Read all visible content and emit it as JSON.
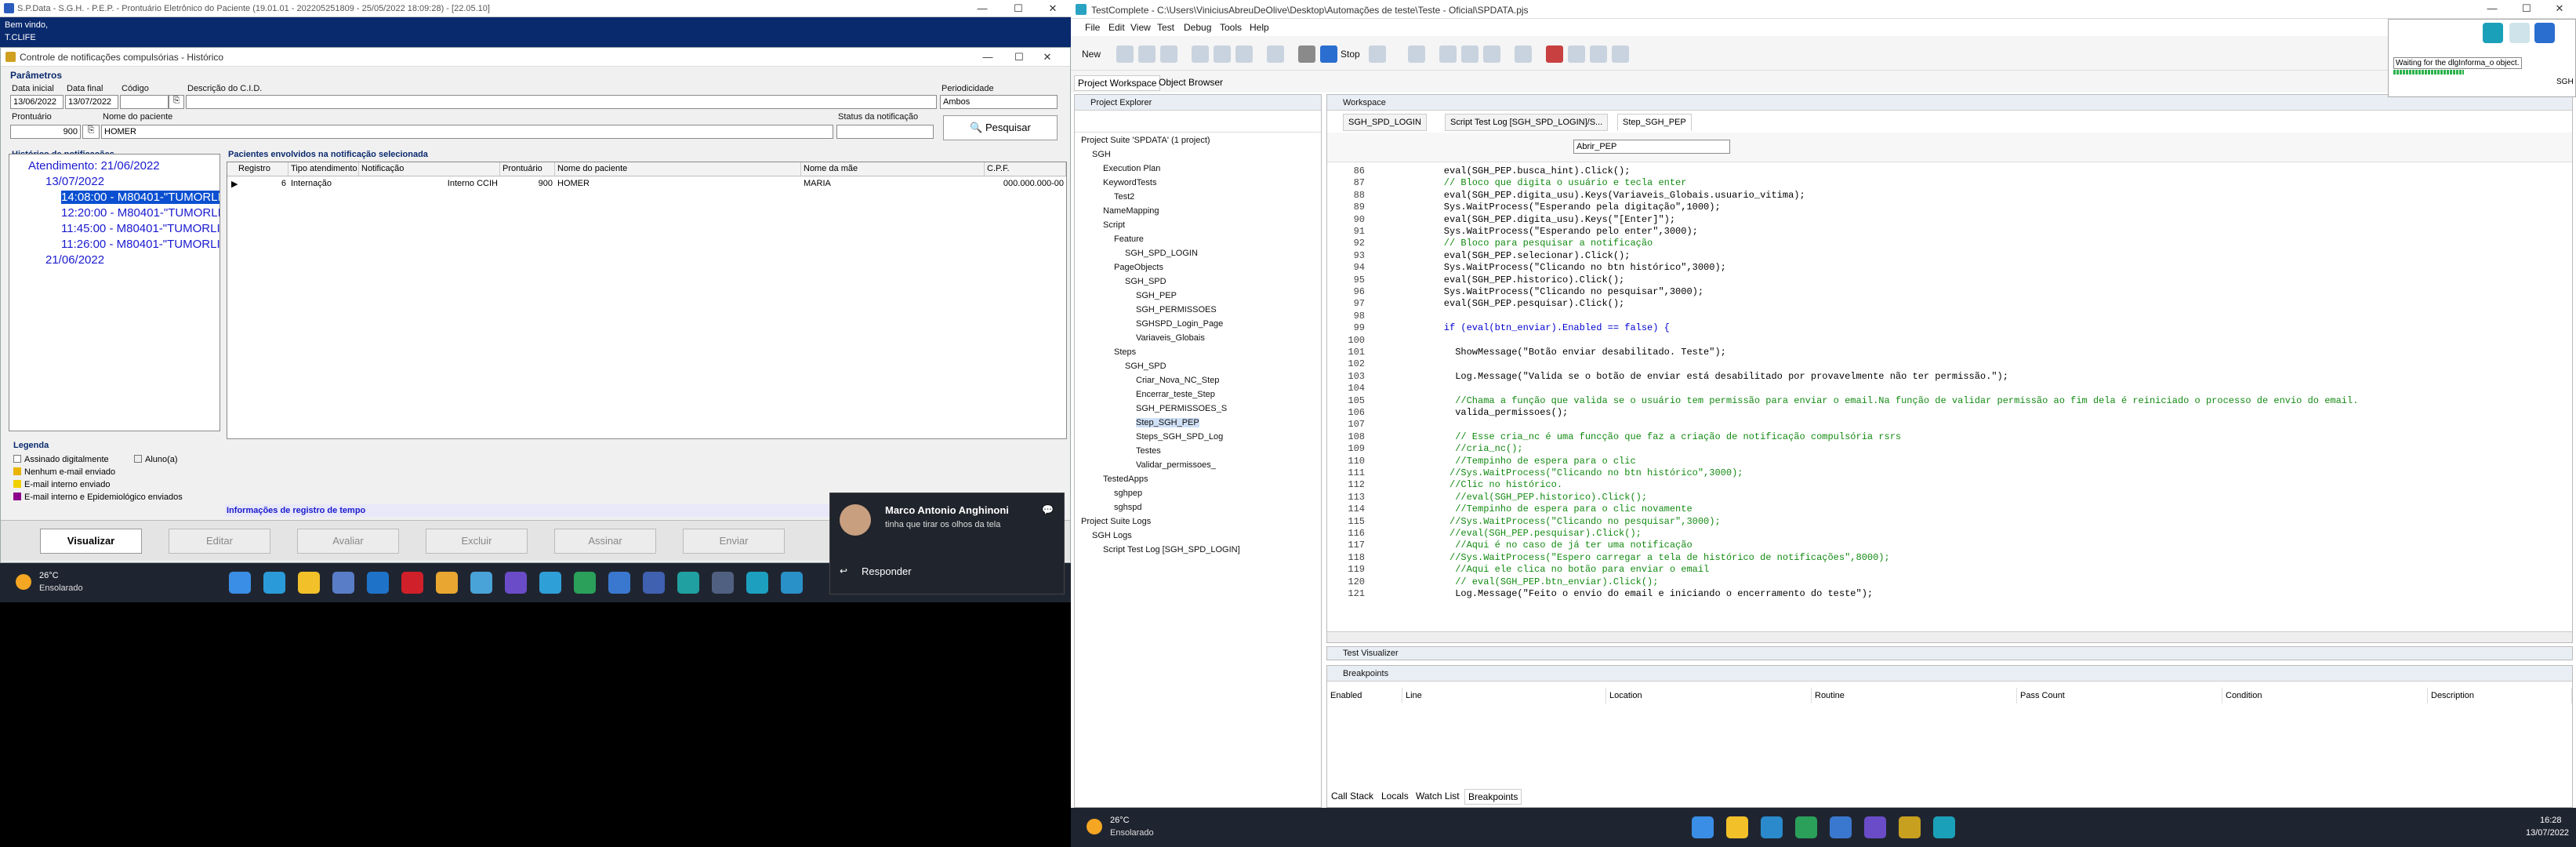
{
  "left": {
    "window_title": "S.P.Data - S.G.H. - P.E.P. - Prontuário Eletrônico do Paciente (19.01.01 - 202205251809 - 25/05/2022 18:09:28) - [22.05.10]",
    "app_header": [
      "Bem vindo,",
      "T.CLIFE"
    ],
    "dialog_title": "Controle de notificações compulsórias - Histórico",
    "params_title": "Parâmetros",
    "labels": {
      "data_inicial": "Data inicial",
      "data_final": "Data final",
      "codigo": "Código",
      "descricao": "Descrição do C.I.D.",
      "periodicidade": "Periodicidade",
      "prontuario": "Prontuário",
      "nome_paciente": "Nome do paciente",
      "status": "Status da notificação"
    },
    "values": {
      "data_inicial": "13/06/2022",
      "data_final": "13/07/2022",
      "periodicidade": "Ambos",
      "prontuario": "900",
      "nome_paciente": "HOMER"
    },
    "search_label": "Pesquisar",
    "history_title": "Histórico de notificações",
    "tree": [
      "Atendimento: 21/06/2022",
      "13/07/2022",
      "14:08:00 - M80401-\"TUMORLI",
      "12:20:00 - M80401-\"TUMORLI",
      "11:45:00 - M80401-\"TUMORLI",
      "11:26:00 - M80401-\"TUMORLI",
      "21/06/2022"
    ],
    "grid_title": "Pacientes envolvidos na notificação selecionada",
    "grid_headers": [
      "Registro",
      "Tipo atendimento",
      "Notificação",
      "Prontuário",
      "Nome do paciente",
      "Nome da mãe",
      "C.P.F."
    ],
    "grid_row": [
      "6",
      "Internação",
      "Interno CCIH",
      "900",
      "HOMER",
      "MARIA",
      "000.000.000-00"
    ],
    "legend_title": "Legenda",
    "legend": [
      "Assinado digitalmente",
      "Aluno(a)",
      "Nenhum e-mail enviado",
      "E-mail interno enviado",
      "E-mail interno e Epidemiológico enviados"
    ],
    "info_link": "Informações de registro de tempo",
    "buttons": [
      "Visualizar",
      "Editar",
      "Avaliar",
      "Excluir",
      "Assinar",
      "Enviar"
    ],
    "weather": {
      "temp": "26°C",
      "desc": "Ensolarado"
    },
    "toast": {
      "name": "Marco Antonio Anghinoni",
      "msg": "tinha que tirar os olhos da tela",
      "action": "Responder"
    }
  },
  "right": {
    "window_title": "TestComplete - C:\\Users\\ViniciusAbreuDeOlive\\Desktop\\Automações de teste\\Teste - Oficial\\SPDATA.pjs",
    "menu": [
      "File",
      "Edit",
      "View",
      "Test",
      "Debug",
      "Tools",
      "Help"
    ],
    "new_label": "New",
    "stop_label": "Stop",
    "top_tabs": [
      "Project Workspace",
      "Object Browser"
    ],
    "panel_explorer": "Project Explorer",
    "panel_workspace": "Workspace",
    "explorer": [
      {
        "t": "Project Suite 'SPDATA' (1 project)",
        "d": 0
      },
      {
        "t": "SGH",
        "d": 1
      },
      {
        "t": "Execution Plan",
        "d": 2
      },
      {
        "t": "KeywordTests",
        "d": 2
      },
      {
        "t": "Test2",
        "d": 3
      },
      {
        "t": "NameMapping",
        "d": 2
      },
      {
        "t": "Script",
        "d": 2
      },
      {
        "t": "Feature",
        "d": 3
      },
      {
        "t": "SGH_SPD_LOGIN",
        "d": 4
      },
      {
        "t": "PageObjects",
        "d": 3
      },
      {
        "t": "SGH_SPD",
        "d": 4
      },
      {
        "t": "SGH_PEP",
        "d": 5
      },
      {
        "t": "SGH_PERMISSOES",
        "d": 5
      },
      {
        "t": "SGHSPD_Login_Page",
        "d": 5
      },
      {
        "t": "Variaveis_Globais",
        "d": 5
      },
      {
        "t": "Steps",
        "d": 3
      },
      {
        "t": "SGH_SPD",
        "d": 4
      },
      {
        "t": "Criar_Nova_NC_Step",
        "d": 5
      },
      {
        "t": "Encerrar_teste_Step",
        "d": 5
      },
      {
        "t": "SGH_PERMISSOES_S",
        "d": 5
      },
      {
        "t": "Step_SGH_PEP",
        "d": 5
      },
      {
        "t": "Steps_SGH_SPD_Log",
        "d": 5
      },
      {
        "t": "Testes",
        "d": 5
      },
      {
        "t": "Validar_permissoes_",
        "d": 5
      },
      {
        "t": "TestedApps",
        "d": 2
      },
      {
        "t": "sghpep",
        "d": 3
      },
      {
        "t": "sghspd",
        "d": 3
      },
      {
        "t": "Project Suite Logs",
        "d": 0
      },
      {
        "t": "SGH Logs",
        "d": 1
      },
      {
        "t": "Script Test Log [SGH_SPD_LOGIN]",
        "d": 2
      }
    ],
    "editor_tabs": [
      "SGH_SPD_LOGIN",
      "Script Test Log [SGH_SPD_LOGIN]/S...",
      "Step_SGH_PEP"
    ],
    "routine": "Abrir_PEP",
    "code": [
      {
        "n": "86",
        "c": "    eval(SGH_PEP.busca_hint).Click();",
        "k": ""
      },
      {
        "n": "87",
        "c": "    // Bloco que digita o usuário e tecla enter",
        "k": "cm"
      },
      {
        "n": "88",
        "c": "    eval(SGH_PEP.digita_usu).Keys(Variaveis_Globais.usuario_vitima);",
        "k": ""
      },
      {
        "n": "89",
        "c": "    Sys.WaitProcess(\"Esperando pela digitação\",1000);",
        "k": ""
      },
      {
        "n": "90",
        "c": "    eval(SGH_PEP.digita_usu).Keys(\"[Enter]\");",
        "k": ""
      },
      {
        "n": "91",
        "c": "    Sys.WaitProcess(\"Esperando pelo enter\",3000);",
        "k": ""
      },
      {
        "n": "92",
        "c": "    // Bloco para pesquisar a notificação",
        "k": "cm"
      },
      {
        "n": "93",
        "c": "    eval(SGH_PEP.selecionar).Click();",
        "k": ""
      },
      {
        "n": "94",
        "c": "    Sys.WaitProcess(\"Clicando no btn histórico\",3000);",
        "k": ""
      },
      {
        "n": "95",
        "c": "    eval(SGH_PEP.historico).Click();",
        "k": ""
      },
      {
        "n": "96",
        "c": "    Sys.WaitProcess(\"Clicando no pesquisar\",3000);",
        "k": ""
      },
      {
        "n": "97",
        "c": "    eval(SGH_PEP.pesquisar).Click();",
        "k": ""
      },
      {
        "n": "98",
        "c": "",
        "k": ""
      },
      {
        "n": "99",
        "c": "    if (eval(btn_enviar).Enabled == false) {",
        "k": "kw"
      },
      {
        "n": "100",
        "c": "",
        "k": ""
      },
      {
        "n": "101",
        "c": "      ShowMessage(\"Botão enviar desabilitado. Teste\");",
        "k": ""
      },
      {
        "n": "102",
        "c": "",
        "k": ""
      },
      {
        "n": "103",
        "c": "      Log.Message(\"Valida se o botão de enviar está desabilitado por provavelmente não ter permissão.\");",
        "k": ""
      },
      {
        "n": "104",
        "c": "",
        "k": ""
      },
      {
        "n": "105",
        "c": "      //Chama a função que valida se o usuário tem permissão para enviar o email.Na função de validar permissão ao fim dela é reiniciado o processo de envio do email.",
        "k": "cm"
      },
      {
        "n": "106",
        "c": "      valida_permissoes();",
        "k": ""
      },
      {
        "n": "107",
        "c": "",
        "k": ""
      },
      {
        "n": "108",
        "c": "      // Esse cria_nc é uma funcção que faz a criação de notificação compulsória rsrs",
        "k": "cm"
      },
      {
        "n": "109",
        "c": "      //cria_nc();",
        "k": "cm"
      },
      {
        "n": "110",
        "c": "      //Tempinho de espera para o clic",
        "k": "cm"
      },
      {
        "n": "111",
        "c": "     //Sys.WaitProcess(\"Clicando no btn histórico\",3000);",
        "k": "cm"
      },
      {
        "n": "112",
        "c": "     //Clic no histórico.",
        "k": "cm"
      },
      {
        "n": "113",
        "c": "      //eval(SGH_PEP.historico).Click();",
        "k": "cm"
      },
      {
        "n": "114",
        "c": "      //Tempinho de espera para o clic novamente",
        "k": "cm"
      },
      {
        "n": "115",
        "c": "     //Sys.WaitProcess(\"Clicando no pesquisar\",3000);",
        "k": "cm"
      },
      {
        "n": "116",
        "c": "     //eval(SGH_PEP.pesquisar).Click();",
        "k": "cm"
      },
      {
        "n": "117",
        "c": "      //Aqui é no caso de já ter uma notificação",
        "k": "cm"
      },
      {
        "n": "118",
        "c": "     //Sys.WaitProcess(\"Espero carregar a tela de histórico de notificações\",8000);",
        "k": "cm"
      },
      {
        "n": "119",
        "c": "      //Aqui ele clica no botão para enviar o email",
        "k": "cm"
      },
      {
        "n": "120",
        "c": "      // eval(SGH_PEP.btn_enviar).Click();",
        "k": "cm"
      },
      {
        "n": "121",
        "c": "      Log.Message(\"Feito o envio do email e iniciando o encerramento do teste\");",
        "k": ""
      }
    ],
    "test_visualizer": "Test Visualizer",
    "breakpoints": "Breakpoints",
    "bp_headers": [
      "Enabled",
      "Line",
      "Location",
      "Routine",
      "Pass Count",
      "Condition",
      "Description"
    ],
    "bottom_tabs": [
      "Call Stack",
      "Locals",
      "Watch List",
      "Breakpoints"
    ],
    "dialog": {
      "text": "Waiting for the dlgInforma_o object.",
      "sgh": "SGH"
    },
    "weather": {
      "temp": "26°C",
      "desc": "Ensolarado"
    },
    "clock": {
      "time": "16:28",
      "date": "13/07/2022"
    }
  }
}
